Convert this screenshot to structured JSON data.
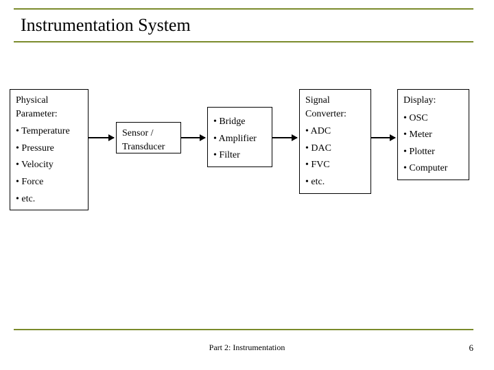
{
  "title": "Instrumentation System",
  "blocks": {
    "physical": {
      "header": "Physical Parameter:",
      "items": [
        "• Temperature",
        "• Pressure",
        "• Velocity",
        "• Force",
        "• etc."
      ]
    },
    "sensor": {
      "label_l1": "Sensor /",
      "label_l2": "Transducer"
    },
    "conditioning": {
      "items": [
        "• Bridge",
        "• Amplifier",
        "• Filter"
      ]
    },
    "converter": {
      "header": "Signal Converter:",
      "items": [
        "• ADC",
        "• DAC",
        "• FVC",
        "• etc."
      ]
    },
    "display": {
      "header": "Display:",
      "items": [
        "• OSC",
        "• Meter",
        "• Plotter",
        "• Computer"
      ]
    }
  },
  "footer": {
    "center": "Part 2: Instrumentation",
    "page": "6"
  }
}
